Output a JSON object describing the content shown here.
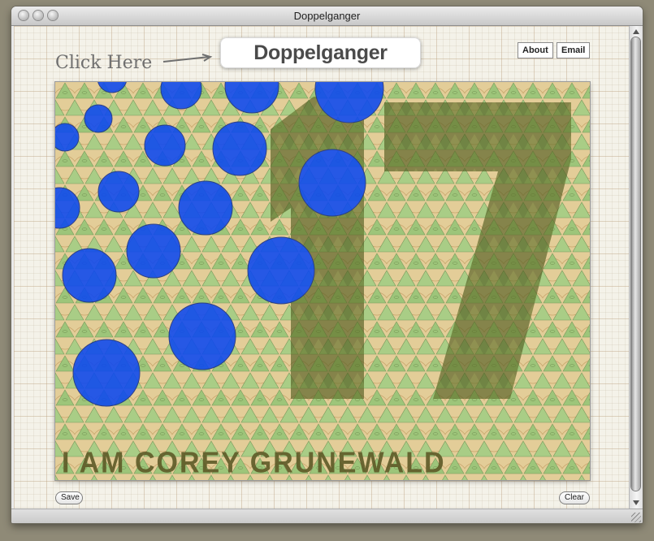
{
  "window": {
    "title": "Doppelganger"
  },
  "header": {
    "click_here": "Click Here",
    "logo": "Doppelganger",
    "about_label": "About",
    "email_label": "Email"
  },
  "canvas": {
    "signature": "I AM COREY GRUNEWALD",
    "number": "17",
    "pattern_colors": {
      "green": "#9dc57a",
      "tan": "#e8c48a",
      "dark_olive": "#4f5a1e",
      "circle_blue": "#0c48f0"
    }
  },
  "footer": {
    "save_label": "Save",
    "clear_label": "Clear"
  },
  "icons": [
    "close-icon",
    "minimize-icon",
    "zoom-icon",
    "arrow-icon",
    "resize-grip-icon"
  ]
}
